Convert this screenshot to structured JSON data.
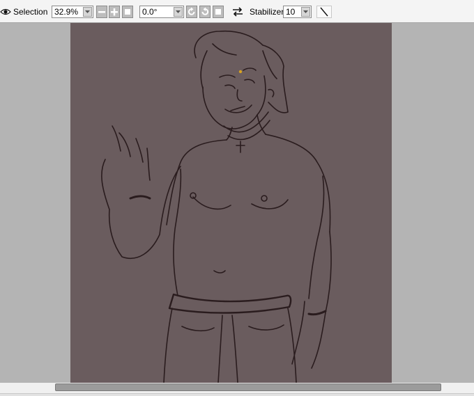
{
  "toolbar": {
    "eye_icon": "eye-icon",
    "selection_label": "Selection",
    "zoom_value": "32.9%",
    "rotation_value": "0.0°",
    "stabilizer_label": "Stabilizer",
    "stabilizer_value": "10",
    "buttons": [
      "zoom-out",
      "zoom-in",
      "zoom-reset",
      "rotate-left",
      "rotate-right",
      "rotate-reset",
      "flip-horizontal",
      "pen-tool"
    ]
  },
  "canvas": {
    "background": "#b4b4b4",
    "artboard_color": "#6a5c5e",
    "line_color": "#2a1c1e"
  },
  "scrollbar": {
    "track_color": "#f0f0f0",
    "thumb_color": "#9b9b9b"
  }
}
